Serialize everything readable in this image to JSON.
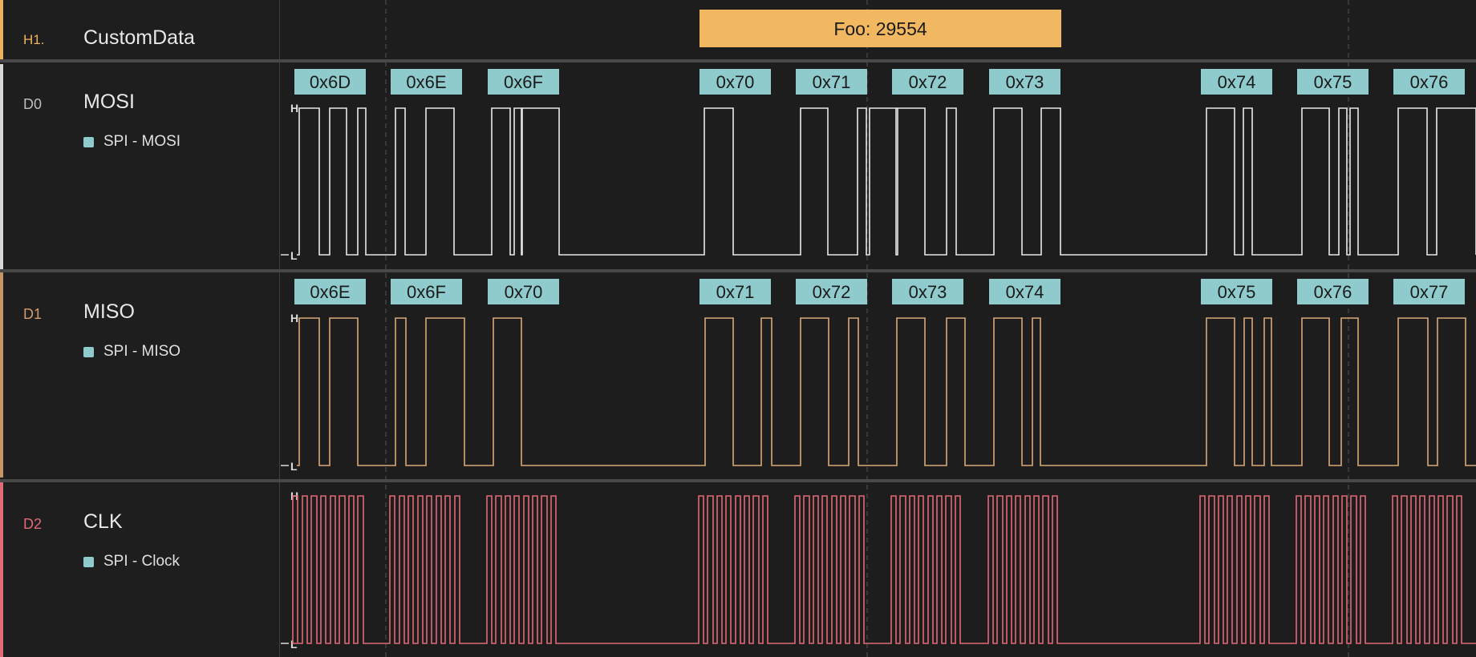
{
  "colors": {
    "background": "#1d1d1d",
    "header_accent": "#f0b15c",
    "mosi_trace": "#e8e8e8",
    "miso_trace": "#d9a878",
    "clock_trace": "#e06a76",
    "byte_box": "#8fcbcc",
    "custom_box": "#f2b861"
  },
  "rows": [
    {
      "id": "H1.",
      "name": "CustomData",
      "accent": "#f0b15c",
      "id_color": "#f0b15c"
    },
    {
      "id": "D0",
      "name": "MOSI",
      "analyzer": "SPI - MOSI",
      "accent": "#d8d8d8",
      "id_color": "#bdbdbd"
    },
    {
      "id": "D1",
      "name": "MISO",
      "analyzer": "SPI - MISO",
      "accent": "#c79666",
      "id_color": "#d19a6c"
    },
    {
      "id": "D2",
      "name": "CLK",
      "analyzer": "SPI - Clock",
      "accent": "#e06a76",
      "id_color": "#e06a76"
    }
  ],
  "level_labels": {
    "high": "H",
    "low": "L"
  },
  "custom_frame": {
    "label": "Foo: 29554"
  },
  "mosi_bytes": [
    "0x6D",
    "0x6E",
    "0x6F",
    "0x70",
    "0x71",
    "0x72",
    "0x73",
    "0x74",
    "0x75",
    "0x76"
  ],
  "miso_bytes": [
    "0x6E",
    "0x6F",
    "0x70",
    "0x71",
    "0x72",
    "0x73",
    "0x74",
    "0x75",
    "0x76",
    "0x77"
  ]
}
